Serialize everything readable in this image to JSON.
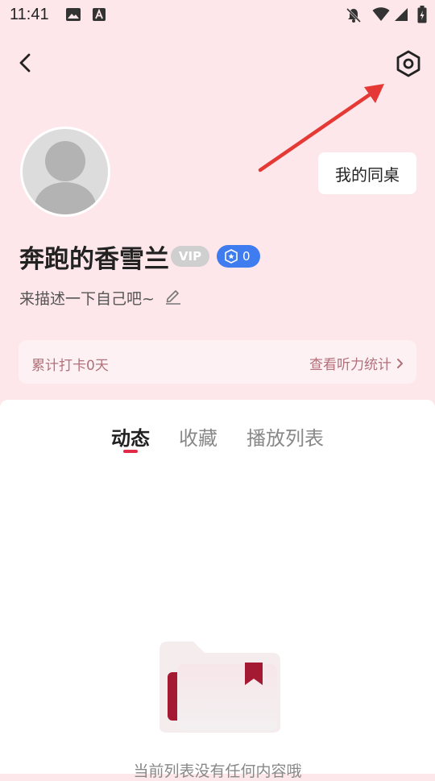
{
  "status_bar": {
    "time": "11:41",
    "icons": [
      "image-icon",
      "font-a-icon",
      "bell-off-icon",
      "wifi-icon",
      "cell-signal-icon",
      "battery-icon"
    ]
  },
  "nav": {
    "back_icon": "chevron-left-icon",
    "settings_icon": "settings-hex-icon"
  },
  "profile": {
    "deskmate_label": "我的同桌",
    "username": "奔跑的香雪兰",
    "vip_label": "VIP",
    "level": "0",
    "bio_placeholder": "来描述一下自己吧~"
  },
  "stats": {
    "checkin_text": "累计打卡0天",
    "listen_stats_link": "查看听力统计"
  },
  "tabs": [
    {
      "label": "动态",
      "active": true
    },
    {
      "label": "收藏",
      "active": false
    },
    {
      "label": "播放列表",
      "active": false
    }
  ],
  "empty_state": {
    "message": "当前列表没有任何内容哦"
  },
  "colors": {
    "header_bg": "#fde7ea",
    "accent_red": "#e02a48",
    "level_blue": "#3f7cf0",
    "annotation_arrow": "#e53935"
  }
}
